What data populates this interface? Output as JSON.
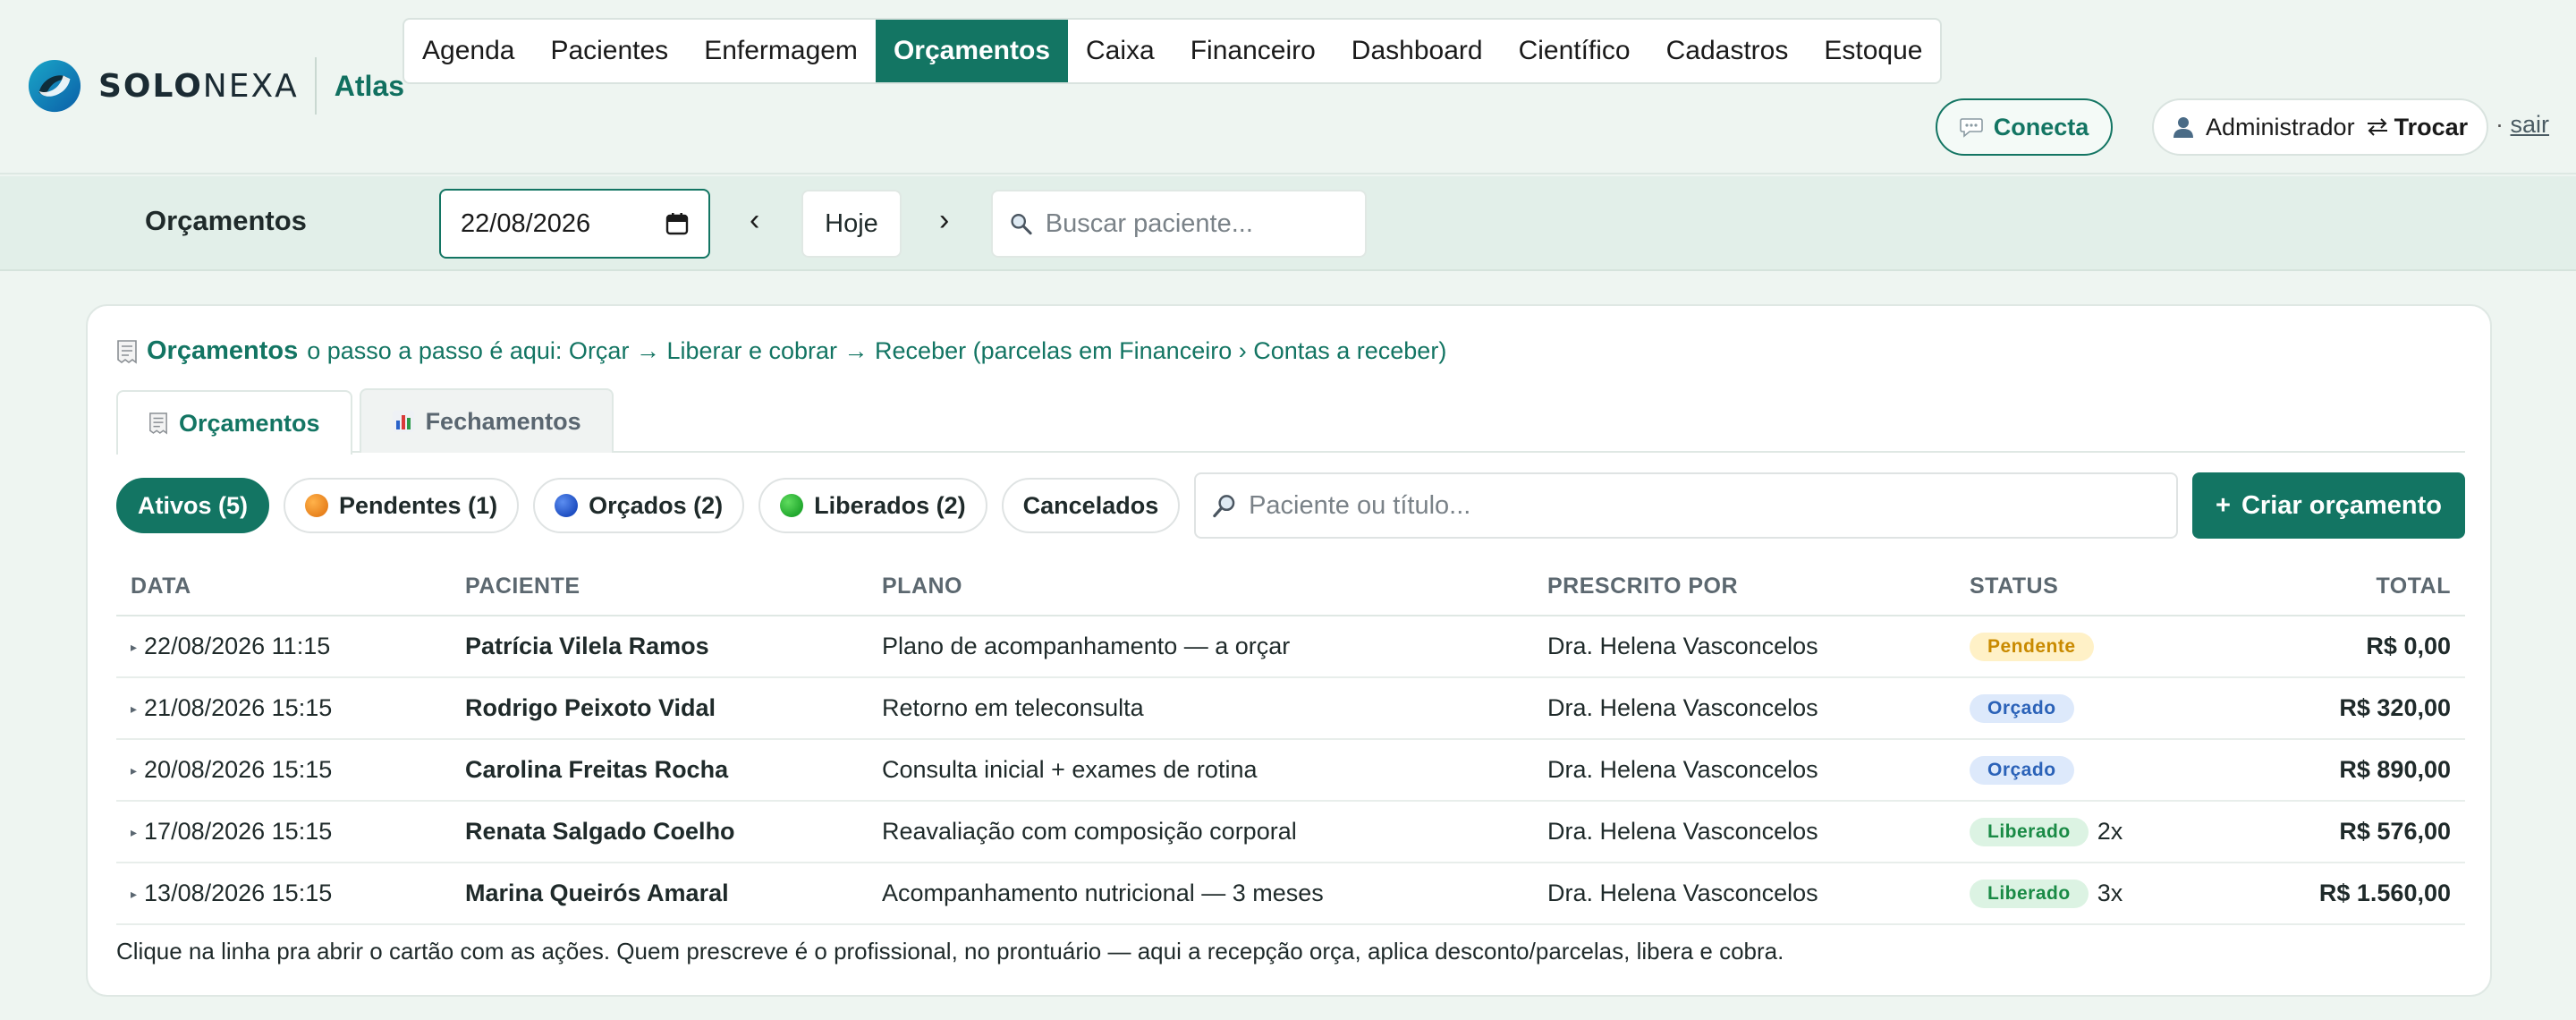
{
  "brand": {
    "name_bold": "SOLO",
    "name_light": "NEXA",
    "product": "Atlas"
  },
  "nav": {
    "items": [
      {
        "label": "Agenda",
        "active": false
      },
      {
        "label": "Pacientes",
        "active": false
      },
      {
        "label": "Enfermagem",
        "active": false
      },
      {
        "label": "Orçamentos",
        "active": true
      },
      {
        "label": "Caixa",
        "active": false
      },
      {
        "label": "Financeiro",
        "active": false
      },
      {
        "label": "Dashboard",
        "active": false
      },
      {
        "label": "Científico",
        "active": false
      },
      {
        "label": "Cadastros",
        "active": false
      },
      {
        "label": "Estoque",
        "active": false
      }
    ]
  },
  "header": {
    "conecta_label": "Conecta",
    "user_name": "Administrador",
    "switch_label": "Trocar",
    "logout_separator": "·",
    "logout_label": "sair"
  },
  "toolbar": {
    "title": "Orçamentos",
    "date_value": "22/08/2026",
    "prev_label": "‹",
    "today_label": "Hoje",
    "next_label": "›",
    "search_placeholder": "Buscar paciente..."
  },
  "card": {
    "hint_title": "Orçamentos",
    "hint_text": "o passo a passo é aqui: Orçar → Liberar e cobrar → Receber (parcelas em Financeiro › Contas a receber)",
    "tabs": [
      {
        "label": "Orçamentos",
        "active": true
      },
      {
        "label": "Fechamentos",
        "active": false
      }
    ],
    "filters": {
      "active_label": "Ativos (5)",
      "pending_label": "Pendentes (1)",
      "quoted_label": "Orçados (2)",
      "released_label": "Liberados (2)",
      "cancelled_label": "Cancelados",
      "search_placeholder": "Paciente ou título...",
      "create_label": "Criar orçamento",
      "create_icon": "+"
    },
    "table": {
      "columns": [
        "DATA",
        "PACIENTE",
        "PLANO",
        "PRESCRITO POR",
        "STATUS",
        "TOTAL"
      ],
      "rows": [
        {
          "date": "22/08/2026 11:15",
          "patient": "Patrícia Vilela Ramos",
          "plan": "Plano de acompanhamento — a orçar",
          "prescriber": "Dra. Helena Vasconcelos",
          "status": "Pendente",
          "status_kind": "pendente",
          "installments": "",
          "total": "R$ 0,00"
        },
        {
          "date": "21/08/2026 15:15",
          "patient": "Rodrigo Peixoto Vidal",
          "plan": "Retorno em teleconsulta",
          "prescriber": "Dra. Helena Vasconcelos",
          "status": "Orçado",
          "status_kind": "orcado",
          "installments": "",
          "total": "R$ 320,00"
        },
        {
          "date": "20/08/2026 15:15",
          "patient": "Carolina Freitas Rocha",
          "plan": "Consulta inicial + exames de rotina",
          "prescriber": "Dra. Helena Vasconcelos",
          "status": "Orçado",
          "status_kind": "orcado",
          "installments": "",
          "total": "R$ 890,00"
        },
        {
          "date": "17/08/2026 15:15",
          "patient": "Renata Salgado Coelho",
          "plan": "Reavaliação com composição corporal",
          "prescriber": "Dra. Helena Vasconcelos",
          "status": "Liberado",
          "status_kind": "liberado",
          "installments": "2x",
          "total": "R$ 576,00"
        },
        {
          "date": "13/08/2026 15:15",
          "patient": "Marina Queirós Amaral",
          "plan": "Acompanhamento nutricional — 3 meses",
          "prescriber": "Dra. Helena Vasconcelos",
          "status": "Liberado",
          "status_kind": "liberado",
          "installments": "3x",
          "total": "R$ 1.560,00"
        }
      ]
    },
    "footer_note": "Clique na linha pra abrir o cartão com as ações. Quem prescreve é o profissional, no prontuário — aqui a recepção orça, aplica desconto/parcelas, libera e cobra."
  },
  "colors": {
    "brand": "#137563",
    "background": "#eef5f1",
    "pending_dot": "#e8821e",
    "quoted_dot": "#1f4fc2",
    "released_dot": "#22a82e"
  }
}
